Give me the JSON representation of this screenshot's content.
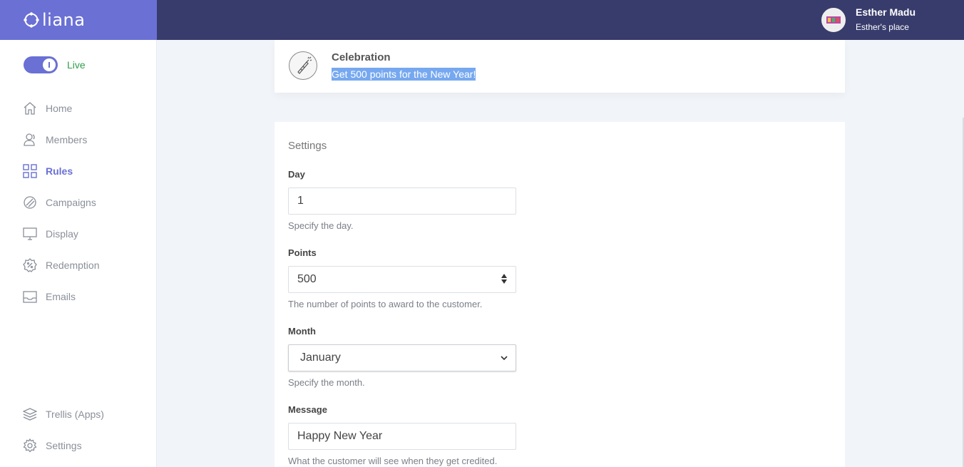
{
  "brand": {
    "name": "liana",
    "color": "#6a70d4"
  },
  "header": {
    "user_name": "Esther Madu",
    "user_place": "Esther's place",
    "bg_color": "#383c6c"
  },
  "sidebar": {
    "live_label": "Live",
    "items": [
      {
        "label": "Home",
        "icon": "home-icon"
      },
      {
        "label": "Members",
        "icon": "members-icon"
      },
      {
        "label": "Rules",
        "icon": "rules-grid-icon",
        "active": true
      },
      {
        "label": "Campaigns",
        "icon": "campaigns-icon"
      },
      {
        "label": "Display",
        "icon": "monitor-icon"
      },
      {
        "label": "Redemption",
        "icon": "redemption-badge-icon"
      },
      {
        "label": "Emails",
        "icon": "inbox-icon"
      }
    ],
    "bottom_items": [
      {
        "label": "Trellis (Apps)",
        "icon": "layers-icon"
      },
      {
        "label": "Settings",
        "icon": "gear-icon"
      }
    ]
  },
  "rule": {
    "title": "Celebration",
    "description": "Get 500 points for the New Year!",
    "icon": "party-popper-icon"
  },
  "settings": {
    "title": "Settings",
    "day": {
      "label": "Day",
      "value": "1",
      "hint": "Specify the day."
    },
    "points": {
      "label": "Points",
      "value": "500",
      "hint": "The number of points to award to the customer."
    },
    "month": {
      "label": "Month",
      "value": "January",
      "hint": "Specify the month."
    },
    "message": {
      "label": "Message",
      "value": "Happy New Year",
      "hint": "What the customer will see when they get credited."
    }
  }
}
